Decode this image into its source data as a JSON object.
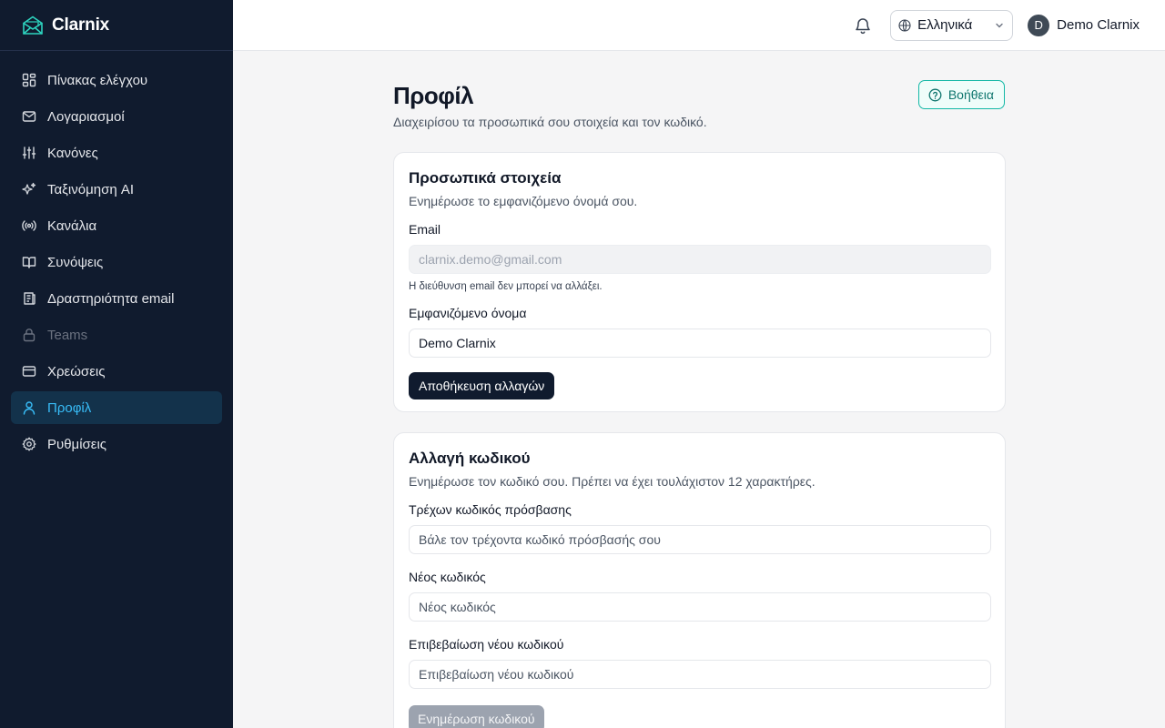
{
  "app": {
    "brand": "Clarnix"
  },
  "sidebar": {
    "items": [
      {
        "label": "Πίνακας ελέγχου",
        "icon": "dashboard-icon"
      },
      {
        "label": "Λογαριασμοί",
        "icon": "mail-icon"
      },
      {
        "label": "Κανόνες",
        "icon": "sliders-icon"
      },
      {
        "label": "Ταξινόμηση AI",
        "icon": "sparkles-icon"
      },
      {
        "label": "Κανάλια",
        "icon": "radio-icon"
      },
      {
        "label": "Συνόψεις",
        "icon": "book-icon"
      },
      {
        "label": "Δραστηριότητα email",
        "icon": "activity-icon"
      },
      {
        "label": "Teams",
        "icon": "lock-icon",
        "disabled": true
      },
      {
        "label": "Χρεώσεις",
        "icon": "credit-card-icon"
      },
      {
        "label": "Προφίλ",
        "icon": "user-icon",
        "active": true
      },
      {
        "label": "Ρυθμίσεις",
        "icon": "gear-icon"
      }
    ]
  },
  "header": {
    "language": "Ελληνικά",
    "user_initial": "D",
    "user_name": "Demo Clarnix"
  },
  "page": {
    "title": "Προφίλ",
    "subtitle": "Διαχειρίσου τα προσωπικά σου στοιχεία και τον κωδικό.",
    "help_label": "Βοήθεια"
  },
  "personal": {
    "title": "Προσωπικά στοιχεία",
    "description": "Ενημέρωσε το εμφανιζόμενο όνομά σου.",
    "email_label": "Email",
    "email_value": "clarnix.demo@gmail.com",
    "email_hint": "Η διεύθυνση email δεν μπορεί να αλλάξει.",
    "display_name_label": "Εμφανιζόμενο όνομα",
    "display_name_value": "Demo Clarnix",
    "save_label": "Αποθήκευση αλλαγών"
  },
  "password": {
    "title": "Αλλαγή κωδικού",
    "description": "Ενημέρωσε τον κωδικό σου. Πρέπει να έχει τουλάχιστον 12 χαρακτήρες.",
    "current_label": "Τρέχων κωδικός πρόσβασης",
    "current_placeholder": "Βάλε τον τρέχοντα κωδικό πρόσβασής σου",
    "new_label": "Νέος κωδικός",
    "new_placeholder": "Νέος κωδικός",
    "confirm_label": "Επιβεβαίωση νέου κωδικού",
    "confirm_placeholder": "Επιβεβαίωση νέου κωδικού",
    "update_label": "Ενημέρωση κωδικού"
  },
  "colors": {
    "sidebar_bg": "#101b2e",
    "accent": "#38bdf8",
    "help_accent": "#14b8a6",
    "primary_button": "#101b2e"
  }
}
